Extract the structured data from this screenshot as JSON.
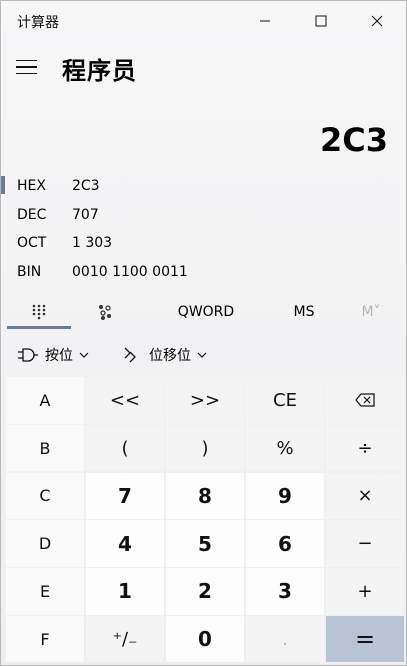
{
  "app": {
    "title": "计算器",
    "mode": "程序员"
  },
  "display": {
    "value": "2C3"
  },
  "radix": [
    {
      "name": "HEX",
      "value": "2C3",
      "selected": true
    },
    {
      "name": "DEC",
      "value": "707",
      "selected": false
    },
    {
      "name": "OCT",
      "value": "1 303",
      "selected": false
    },
    {
      "name": "BIN",
      "value": "0010 1100 0011",
      "selected": false
    }
  ],
  "tabs": {
    "word_size": "QWORD",
    "memory_store": "MS",
    "memory_recall": "M˅"
  },
  "ops": {
    "bitwise": "按位",
    "bitshift": "位移位"
  },
  "keys": [
    [
      "A",
      "<<",
      ">>",
      "CE",
      "⌫"
    ],
    [
      "B",
      "(",
      ")",
      "%",
      "÷"
    ],
    [
      "C",
      "7",
      "8",
      "9",
      "×"
    ],
    [
      "D",
      "4",
      "5",
      "6",
      "−"
    ],
    [
      "E",
      "1",
      "2",
      "3",
      "+"
    ],
    [
      "F",
      "⁺∕₋",
      "0",
      ".",
      "="
    ]
  ],
  "colors": {
    "accent": "#6b7c93",
    "equals_bg": "#b8c3d3"
  }
}
